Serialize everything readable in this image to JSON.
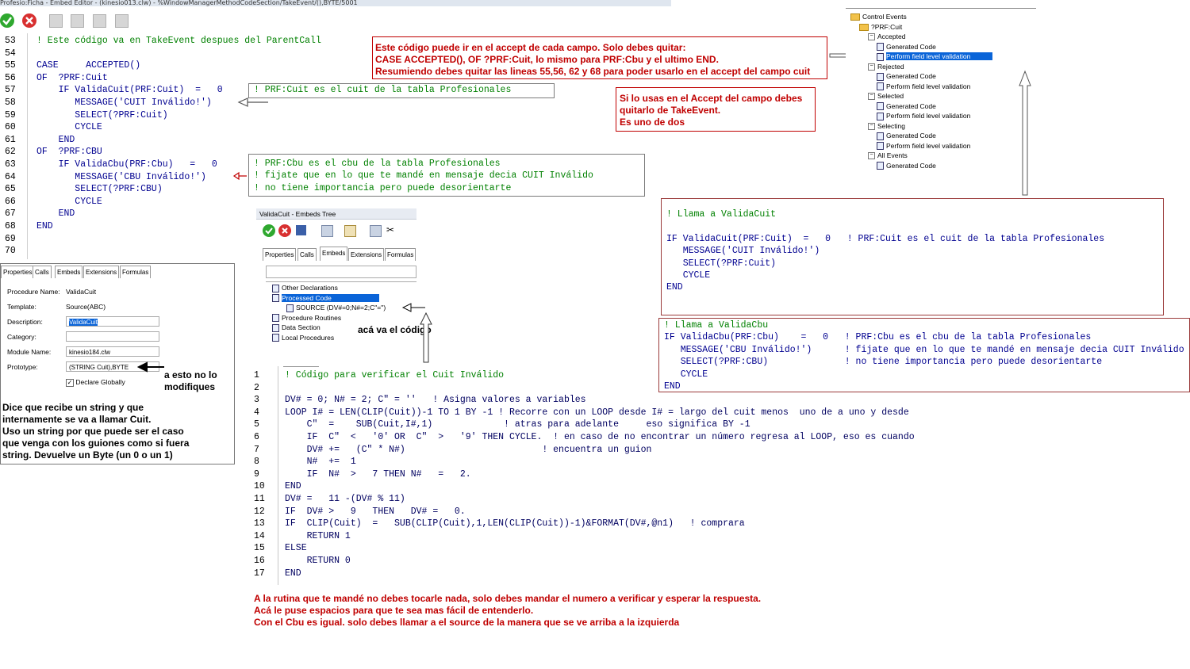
{
  "window": {
    "title": "Profesio:Ficha - Embed Editor - (kinesio013.clw) - %WindowManagerMethodCodeSection/TakeEvent/(),BYTE/5001"
  },
  "toolbar": {
    "ok_icon": "check-icon",
    "cancel_icon": "cancel-icon",
    "colors": {
      "ok": "#2fa82f",
      "cancel": "#d83030"
    }
  },
  "editor": {
    "lines": [
      {
        "n": "53",
        "code": "! Este código va en TakeEvent despues del ParentCall"
      },
      {
        "n": "54",
        "code": ""
      },
      {
        "n": "55",
        "code": "CASE     ACCEPTED()"
      },
      {
        "n": "56",
        "code": "OF  ?PRF:Cuit"
      },
      {
        "n": "57",
        "code": "    IF ValidaCuit(PRF:Cuit)  =   0"
      },
      {
        "n": "58",
        "code": "       MESSAGE('CUIT Inválido!')"
      },
      {
        "n": "59",
        "code": "       SELECT(?PRF:Cuit)"
      },
      {
        "n": "60",
        "code": "       CYCLE"
      },
      {
        "n": "61",
        "code": "    END"
      },
      {
        "n": "62",
        "code": "OF  ?PRF:CBU"
      },
      {
        "n": "63",
        "code": "    IF ValidaCbu(PRF:Cbu)   =   0"
      },
      {
        "n": "64",
        "code": "       MESSAGE('CBU Inválido!')"
      },
      {
        "n": "65",
        "code": "       SELECT(?PRF:CBU)"
      },
      {
        "n": "66",
        "code": "       CYCLE"
      },
      {
        "n": "67",
        "code": "    END"
      },
      {
        "n": "68",
        "code": "END"
      },
      {
        "n": "69",
        "code": ""
      },
      {
        "n": "70",
        "code": ""
      }
    ],
    "comment_cuit": "! PRF:Cuit es el cuit de la tabla Profesionales",
    "comment_cbu": [
      "! PRF:Cbu es el cbu de la tabla Profesionales",
      "! fijate que en lo que te mandé en mensaje decia CUIT Inválido",
      "! no tiene importancia pero puede desorientarte"
    ]
  },
  "notes": {
    "top_red": [
      "Este código puede ir en el accept de cada campo. Solo debes quitar:",
      "CASE ACCEPTED(), OF ?PRF:Cuit,     lo mismo para PRF:Cbu y el ultimo END.",
      "Resumiendo debes quitar las lineas 55,56, 62 y 68 para poder usarlo en el accept del campo cuit"
    ],
    "accept_red": [
      "Si lo usas en el Accept del campo debes",
      "quitarlo de TakeEvent.",
      "Es uno de dos"
    ],
    "props_desc": [
      "Dice que recibe un string y que",
      "internamente se va a llamar Cuit.",
      "Uso un string por que puede ser el caso",
      "que venga con los guiones como si fuera",
      "string.  Devuelve un Byte (un 0 o un 1)"
    ],
    "no_modify": [
      "a esto no lo",
      "modifiques"
    ],
    "code_here": "acá va el código",
    "bottom_red": [
      "A la rutina que te mandé no debes tocarle nada, solo debes mandar el numero a verificar y esperar la respuesta.",
      "Acá le puse espacios para que te sea mas fácil de entenderlo.",
      "Con el Cbu es igual. solo debes llamar a el source de la manera que se ve arriba a la izquierda"
    ]
  },
  "tree": {
    "items": [
      {
        "label": "Control Events",
        "depth": 0,
        "kind": "folder"
      },
      {
        "label": "?PRF:Cuit",
        "depth": 1,
        "kind": "folder"
      },
      {
        "label": "Accepted",
        "depth": 2,
        "kind": "node"
      },
      {
        "label": "Generated Code",
        "depth": 3,
        "kind": "doc"
      },
      {
        "label": "Perform field level validation",
        "depth": 3,
        "kind": "doc",
        "selected": true
      },
      {
        "label": "Rejected",
        "depth": 2,
        "kind": "node"
      },
      {
        "label": "Generated Code",
        "depth": 3,
        "kind": "doc"
      },
      {
        "label": "Perform field level validation",
        "depth": 3,
        "kind": "doc"
      },
      {
        "label": "Selected",
        "depth": 2,
        "kind": "node"
      },
      {
        "label": "Generated Code",
        "depth": 3,
        "kind": "doc"
      },
      {
        "label": "Perform field level validation",
        "depth": 3,
        "kind": "doc"
      },
      {
        "label": "Selecting",
        "depth": 2,
        "kind": "node"
      },
      {
        "label": "Generated Code",
        "depth": 3,
        "kind": "doc"
      },
      {
        "label": "Perform field level validation",
        "depth": 3,
        "kind": "doc"
      },
      {
        "label": "All Events",
        "depth": 2,
        "kind": "node"
      },
      {
        "label": "Generated Code",
        "depth": 3,
        "kind": "doc"
      }
    ],
    "selected_color": "#0a64d8"
  },
  "call_cuit": {
    "lines": [
      "! Llama a ValidaCuit",
      "",
      "IF ValidaCuit(PRF:Cuit)  =   0   ! PRF:Cuit es el cuit de la tabla Profesionales",
      "   MESSAGE('CUIT Inválido!')",
      "   SELECT(?PRF:Cuit)",
      "   CYCLE",
      "END"
    ]
  },
  "call_cbu": {
    "lines": [
      "! Llama a ValidaCbu",
      "IF ValidaCbu(PRF:Cbu)    =   0   ! PRF:Cbu es el cbu de la tabla Profesionales",
      "   MESSAGE('CBU Inválido!')      ! fijate que en lo que te mandé en mensaje decia CUIT Inválido",
      "   SELECT(?PRF:CBU)              ! no tiene importancia pero puede desorientarte",
      "   CYCLE",
      "END"
    ]
  },
  "embeds_window": {
    "title": "ValidaCuit - Embeds Tree",
    "tabs": [
      "Properties",
      "Calls",
      "Embeds",
      "Extensions",
      "Formulas"
    ],
    "active_tab": "Embeds",
    "tree": [
      {
        "label": "Other Declarations",
        "depth": 0
      },
      {
        "label": "Processed Code",
        "depth": 0,
        "selected": true
      },
      {
        "label": "SOURCE (DV#=0;N#=2;C\"='')",
        "depth": 1
      },
      {
        "label": "Procedure Routines",
        "depth": 0
      },
      {
        "label": "Data Section",
        "depth": 0
      },
      {
        "label": "Local Procedures",
        "depth": 0
      }
    ]
  },
  "properties": {
    "tabs": [
      "Properties",
      "Calls",
      "Embeds",
      "Extensions",
      "Formulas"
    ],
    "fields": [
      {
        "label": "Procedure Name:",
        "value": "ValidaCuit",
        "kind": "text"
      },
      {
        "label": "Template:",
        "value": "Source(ABC)",
        "kind": "text"
      },
      {
        "label": "Description:",
        "value": "ValidaCuit",
        "kind": "input-selected"
      },
      {
        "label": "Category:",
        "value": "",
        "kind": "input"
      },
      {
        "label": "Module Name:",
        "value": "kinesio184.clw",
        "kind": "input"
      },
      {
        "label": "Prototype:",
        "value": "(STRING Cuit),BYTE",
        "kind": "input"
      }
    ],
    "declare_globally": "Declare Globally"
  },
  "source_code": {
    "lines": [
      {
        "n": "1",
        "code": "! Código para verificar el Cuit Inválido"
      },
      {
        "n": "2",
        "code": ""
      },
      {
        "n": "3",
        "code": "DV# = 0; N# = 2; C\" = ''   ! Asigna valores a variables"
      },
      {
        "n": "4",
        "code": "LOOP I# = LEN(CLIP(Cuit))-1 TO 1 BY -1 ! Recorre con un LOOP desde I# = largo del cuit menos  uno de a uno y desde"
      },
      {
        "n": "5",
        "code": "    C\"  =    SUB(Cuit,I#,1)             ! atras para adelante     eso significa BY -1"
      },
      {
        "n": "6",
        "code": "    IF  C\"  <   '0' OR  C\"  >   '9' THEN CYCLE.  ! en caso de no encontrar un número regresa al LOOP, eso es cuando"
      },
      {
        "n": "7",
        "code": "    DV# +=   (C\" * N#)                         ! encuentra un guion"
      },
      {
        "n": "8",
        "code": "    N#  +=  1"
      },
      {
        "n": "9",
        "code": "    IF  N#  >   7 THEN N#   =   2."
      },
      {
        "n": "10",
        "code": "END"
      },
      {
        "n": "11",
        "code": "DV# =   11 -(DV# % 11)"
      },
      {
        "n": "12",
        "code": "IF  DV# >   9   THEN   DV# =   0."
      },
      {
        "n": "13",
        "code": "IF  CLIP(Cuit)  =   SUB(CLIP(Cuit),1,LEN(CLIP(Cuit))-1)&FORMAT(DV#,@n1)   ! comprara"
      },
      {
        "n": "14",
        "code": "    RETURN 1"
      },
      {
        "n": "15",
        "code": "ELSE"
      },
      {
        "n": "16",
        "code": "    RETURN 0"
      },
      {
        "n": "17",
        "code": "END"
      }
    ]
  }
}
